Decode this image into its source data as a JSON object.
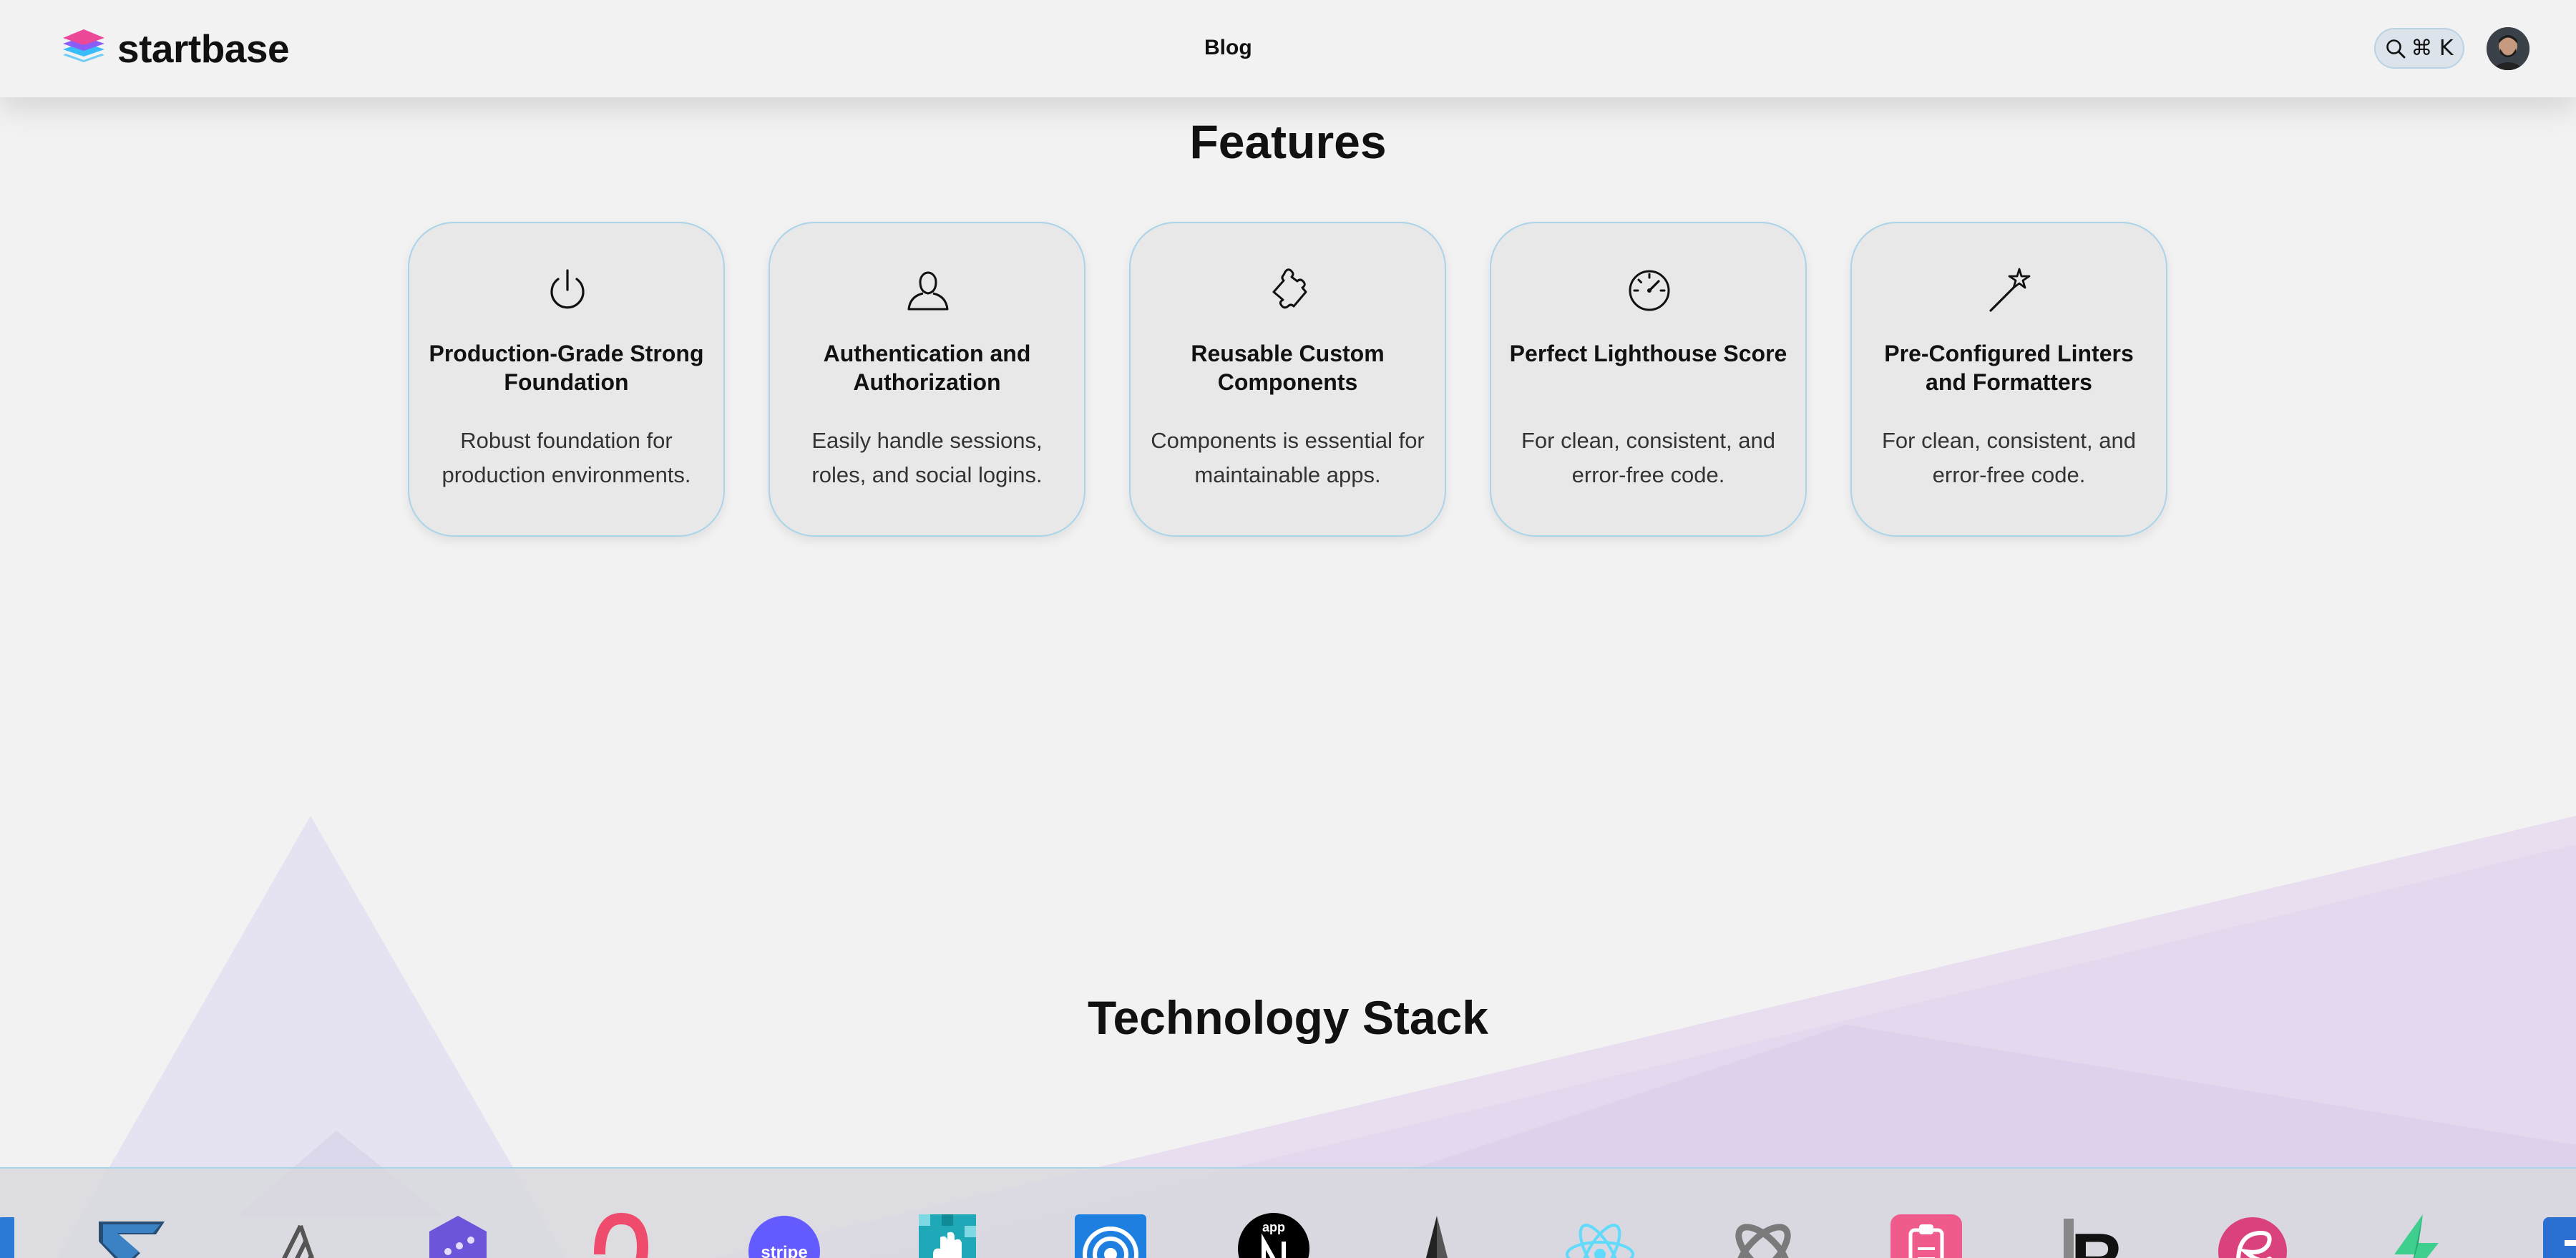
{
  "header": {
    "brand": "startbase",
    "nav_blog": "Blog",
    "search_shortcut": "⌘ K"
  },
  "features": {
    "title": "Features",
    "cards": [
      {
        "icon": "power-icon",
        "title": "Production-Grade Strong Foundation",
        "desc": "Robust foundation for production environments."
      },
      {
        "icon": "user-icon",
        "title": "Authentication and Authorization",
        "desc": "Easily handle sessions, roles, and social logins."
      },
      {
        "icon": "puzzle-icon",
        "title": "Reusable Custom Components",
        "desc": "Components is essential for maintainable apps."
      },
      {
        "icon": "gauge-icon",
        "title": "Perfect Lighthouse Score",
        "desc": "For clean, consistent, and error-free code."
      },
      {
        "icon": "magic-wand-icon",
        "title": "Pre-Configured Linters and Formatters",
        "desc": "For clean, consistent, and error-free code."
      }
    ]
  },
  "tech_stack": {
    "title": "Technology Stack",
    "logos": [
      {
        "name": "partial-logo-icon",
        "label": ""
      },
      {
        "name": "zod-logo-icon",
        "label": ""
      },
      {
        "name": "shadcn-stripe-logo-icon",
        "label": ""
      },
      {
        "name": "hexagon-logo-icon",
        "label": ""
      },
      {
        "name": "pink-loop-logo-icon",
        "label": ""
      },
      {
        "name": "stripe-logo-icon",
        "label": "stripe"
      },
      {
        "name": "hand-pixel-logo-icon",
        "label": ""
      },
      {
        "name": "target-logo-icon",
        "label": ""
      },
      {
        "name": "nextjs-app-logo-icon",
        "label": "app"
      },
      {
        "name": "sail-logo-icon",
        "label": ""
      },
      {
        "name": "react-logo-icon",
        "label": ""
      },
      {
        "name": "atom-logo-icon",
        "label": ""
      },
      {
        "name": "clipboard-logo-icon",
        "label": ""
      },
      {
        "name": "r-logo-icon",
        "label": "R"
      },
      {
        "name": "swirl-logo-icon",
        "label": ""
      },
      {
        "name": "green-bolt-logo-icon",
        "label": ""
      },
      {
        "name": "partial-logo-icon",
        "label": ""
      }
    ]
  },
  "colors": {
    "background": "#f2f2f2",
    "card_bg": "#e8e8e8",
    "card_border": "#a9d4ea",
    "brand_pink": "#ec4899",
    "brand_purple": "#8b5cf6",
    "brand_cyan": "#38bdf8"
  }
}
